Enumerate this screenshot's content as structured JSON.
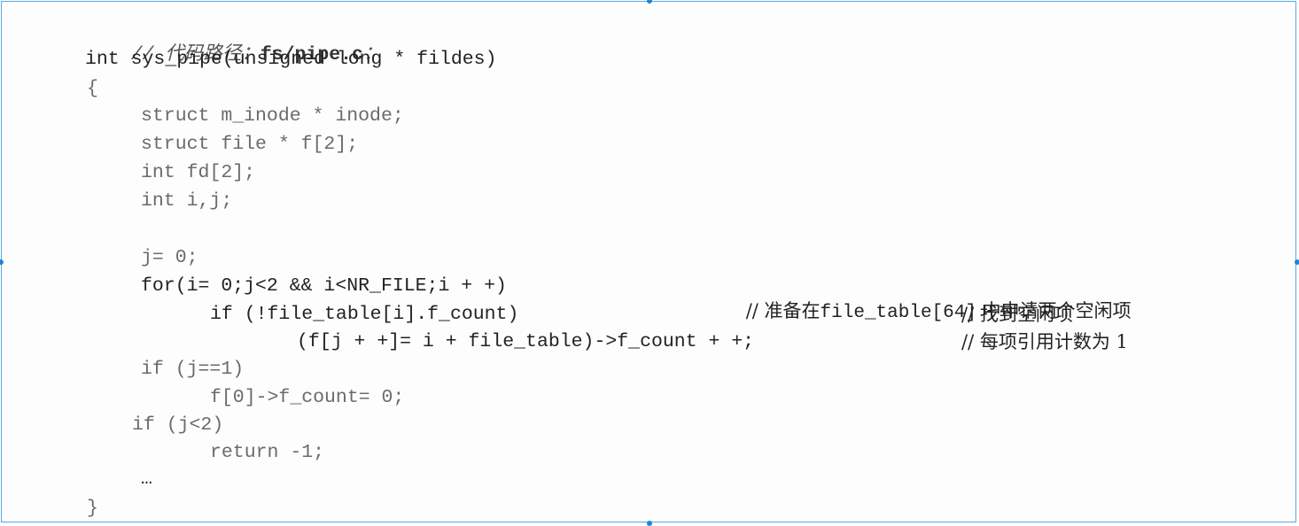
{
  "header_comment": {
    "prefix": "// 代码路径：",
    "path": "fs/pipe.c",
    "suffix": "："
  },
  "code_lines": {
    "signature": "int sys_pipe(unsigned long * fildes)",
    "open_brace": "{",
    "decl_inode": "struct m_inode * inode;",
    "decl_file": "struct file * f[2];",
    "decl_fd": "int fd[2];",
    "decl_ij": "int i,j;",
    "assign_j": "j= 0;",
    "for_loop": "for(i= 0;j<2 && i<NR_FILE;i + +)",
    "if_free": "if (!file_table[i].f_count)",
    "assign_f": "(f[j + +]= i + file_table)->f_count + +;",
    "if_j1": "if (j==1)",
    "reset_count": "f[0]->f_count= 0;",
    "if_j2": "if (j<2)",
    "return_stmt": "return -1;",
    "ellipsis": "…",
    "close_brace": "}"
  },
  "comments": {
    "for_loop_prefix": "// 准备在",
    "for_loop_mono": "file_table[64]",
    "for_loop_suffix": " 中申请两个空闲项",
    "if_free": "// 找到空闲项",
    "assign_f": "// 每项引用计数为 1"
  }
}
